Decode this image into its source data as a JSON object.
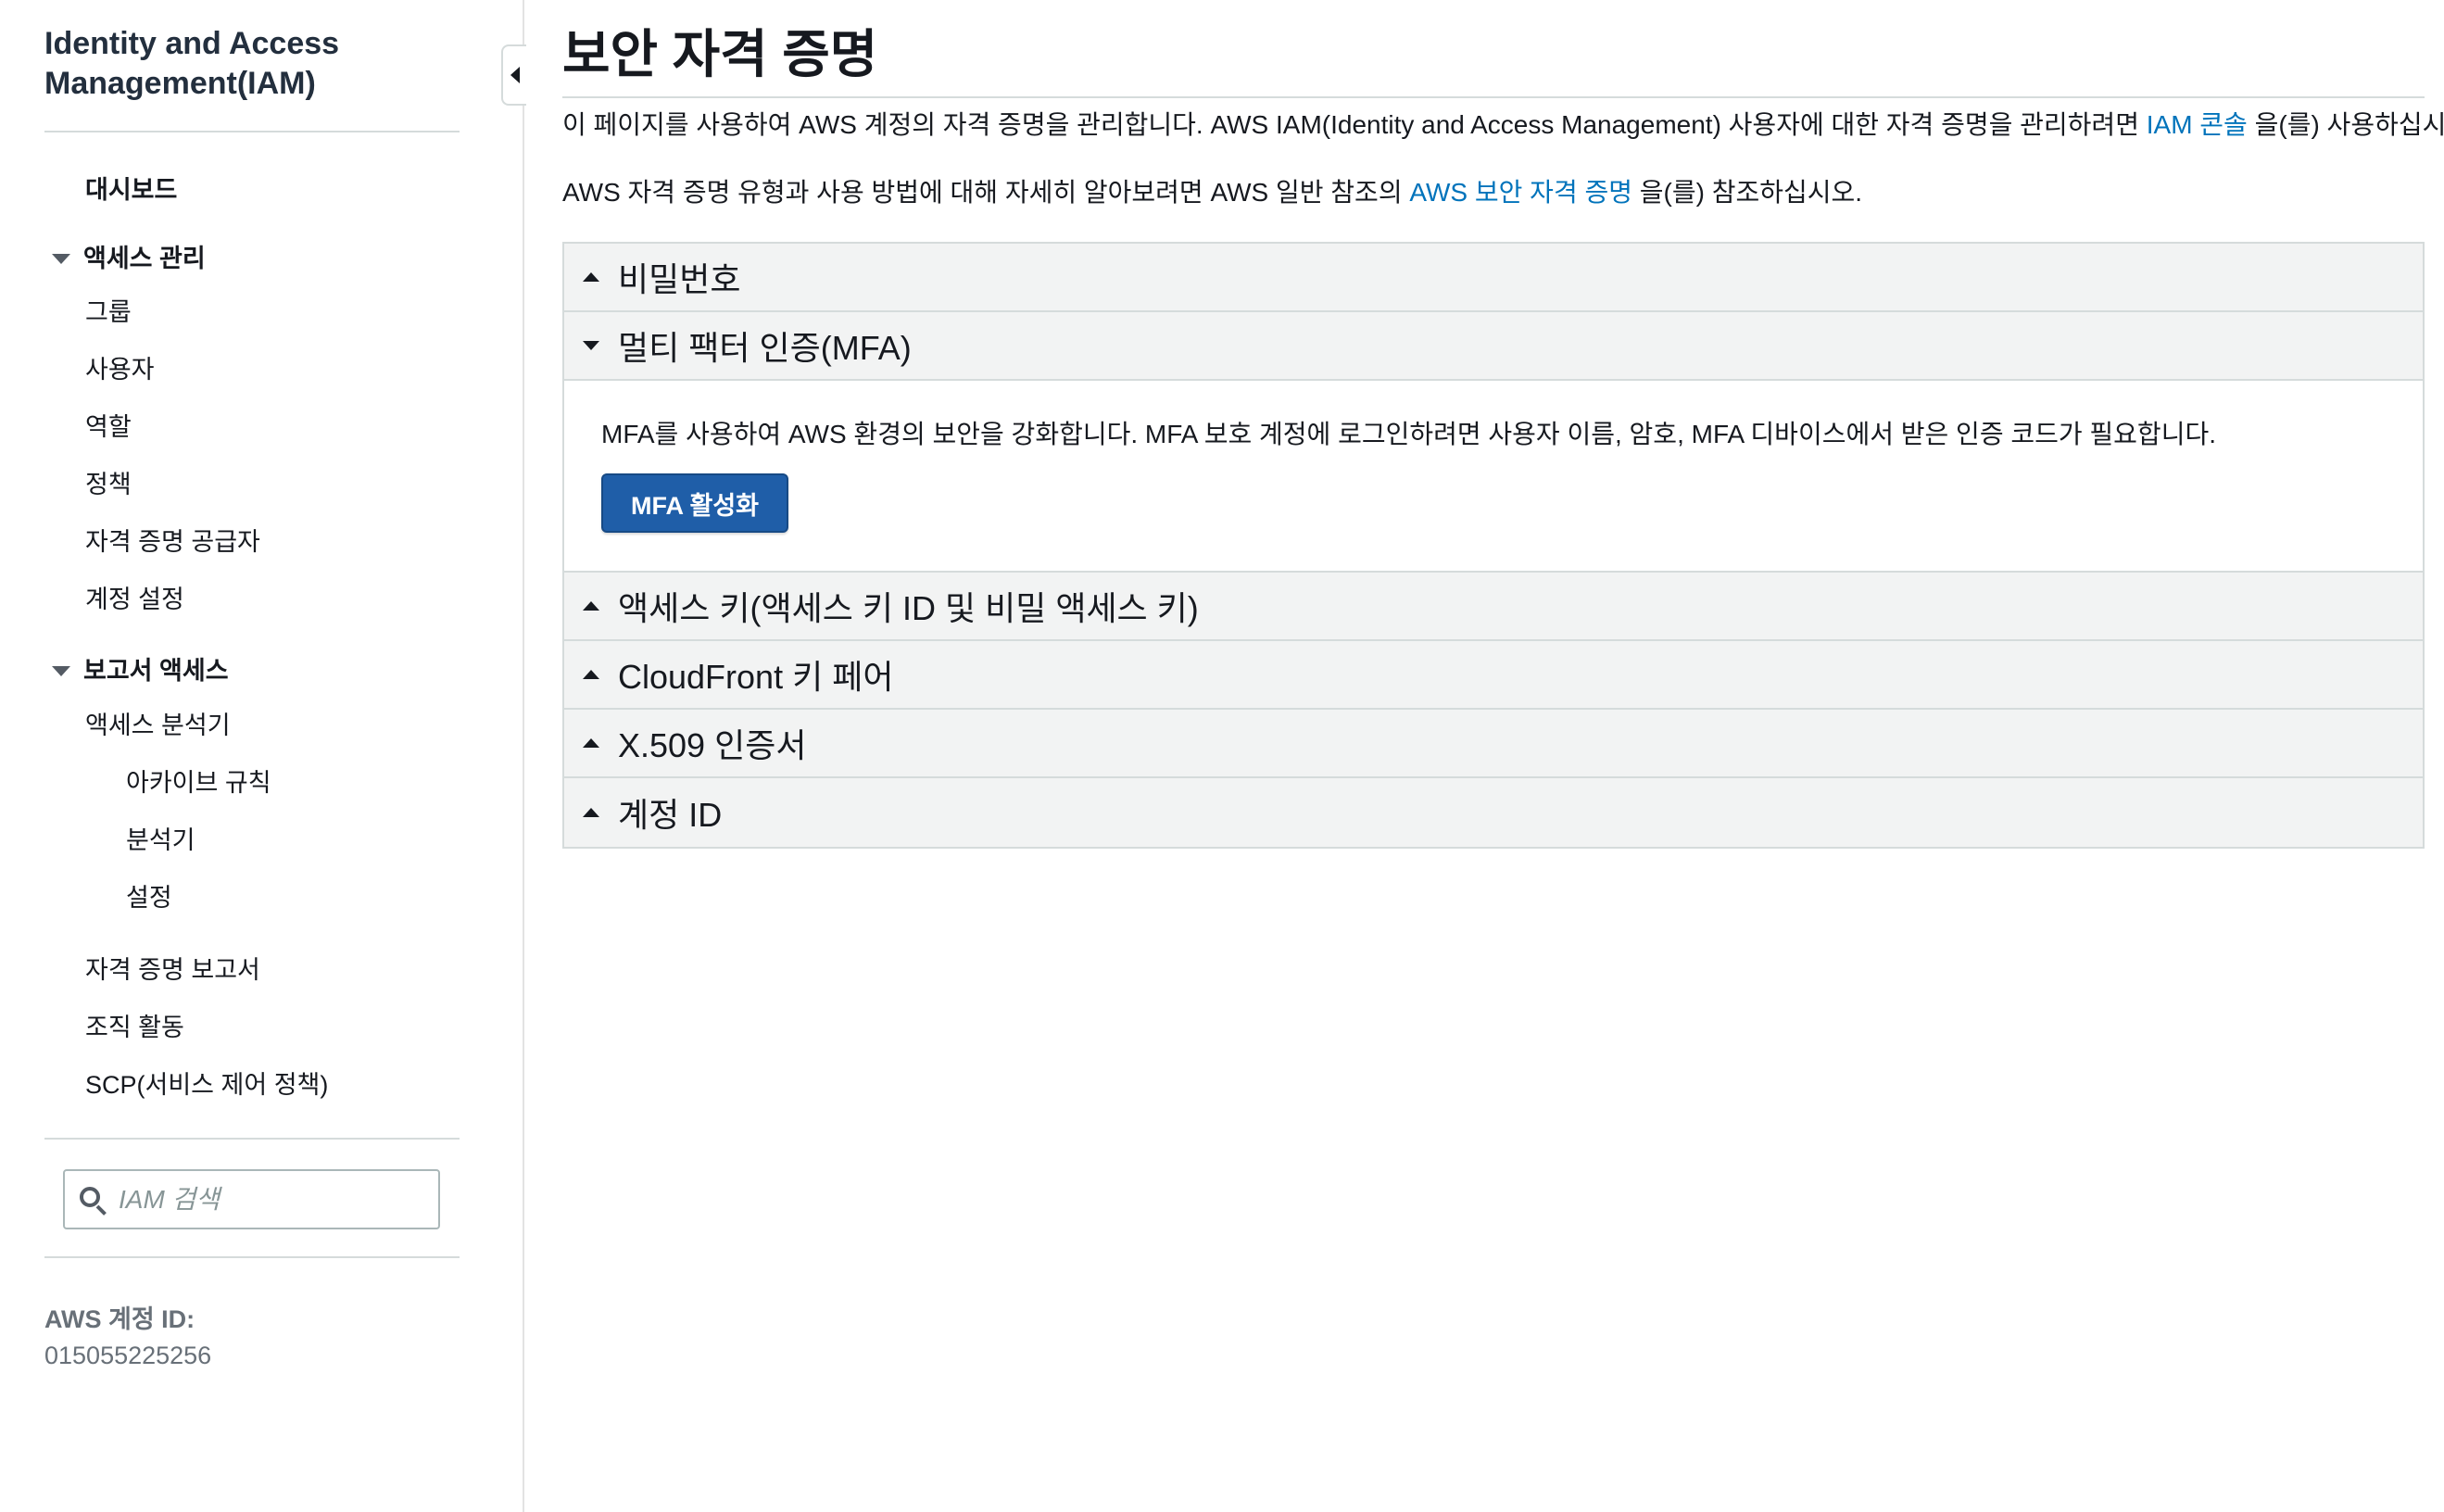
{
  "sidebar": {
    "title": "Identity and Access Management(IAM)",
    "dashboard": "대시보드",
    "access_management": {
      "label": "액세스 관리",
      "items": [
        "그룹",
        "사용자",
        "역할",
        "정책",
        "자격 증명 공급자",
        "계정 설정"
      ]
    },
    "access_reports": {
      "label": "보고서 액세스",
      "analyzer": "액세스 분석기",
      "analyzer_items": [
        "아카이브 규칙",
        "분석기",
        "설정"
      ],
      "items": [
        "자격 증명 보고서",
        "조직 활동",
        "SCP(서비스 제어 정책)"
      ]
    },
    "search": {
      "placeholder": "IAM 검색"
    },
    "account": {
      "label": "AWS 계정 ID:",
      "value": "015055225256"
    }
  },
  "main": {
    "title": "보안 자격 증명",
    "intro": {
      "prefix": "이 페이지를 사용하여 AWS 계정의 자격 증명을 관리합니다. AWS IAM(Identity and Access Management) 사용자에 대한 자격 증명을 관리하려면 ",
      "link": "IAM 콘솔",
      "suffix": " 을(를) 사용하십시오."
    },
    "reference": {
      "prefix": "AWS 자격 증명 유형과 사용 방법에 대해 자세히 알아보려면 AWS 일반 참조의 ",
      "link": "AWS 보안 자격 증명",
      "suffix": " 을(를) 참조하십시오."
    },
    "sections": {
      "password": "비밀번호",
      "mfa": "멀티 팩터 인증(MFA)",
      "access_keys": "액세스 키(액세스 키 ID 및 비밀 액세스 키)",
      "cloudfront": "CloudFront 키 페어",
      "x509": "X.509 인증서",
      "account_id": "계정 ID"
    },
    "mfa_body": {
      "text": "MFA를 사용하여 AWS 환경의 보안을 강화합니다. MFA 보호 계정에 로그인하려면 사용자 이름, 암호, MFA 디바이스에서 받은 인증 코드가 필요합니다.",
      "button": "MFA 활성화"
    }
  },
  "colors": {
    "link": "#0073bb",
    "primary_button": "#1f5ea8",
    "panel_header": "#f2f3f3",
    "border": "#d5dbdb"
  }
}
